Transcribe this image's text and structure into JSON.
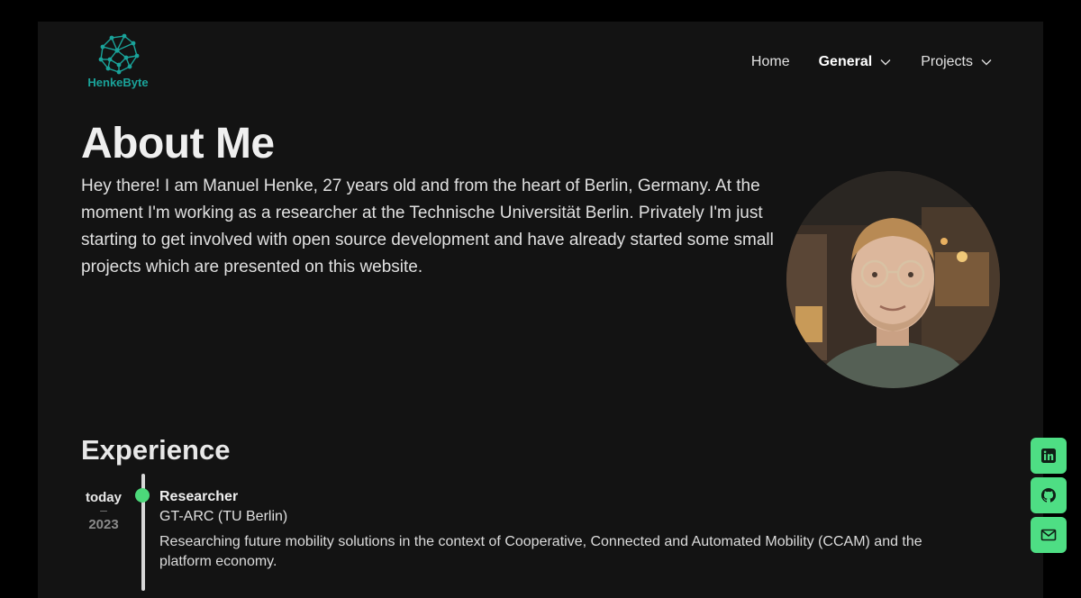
{
  "brand": {
    "name": "HenkeByte",
    "accent": "#1aa39a"
  },
  "nav": {
    "items": [
      {
        "label": "Home"
      },
      {
        "label": "General",
        "active": true,
        "icon": "chevron-down-icon"
      },
      {
        "label": "Projects",
        "icon": "chevron-down-icon"
      }
    ]
  },
  "about": {
    "title": "About Me",
    "text": "Hey there! I am Manuel Henke, 27 years old and from the heart of Berlin, Germany. At the moment I'm working as a researcher at the Technische Universität Berlin. Privately I'm just starting to get involved with open source development and have already started some small projects which are presented on this website."
  },
  "experience": {
    "title": "Experience",
    "entries": [
      {
        "from": "today",
        "dash": "–",
        "to": "2023",
        "role": "Researcher",
        "org": "GT-ARC (TU Berlin)",
        "description": "Researching future mobility solutions in the context of Cooperative, Connected and Automated Mobility (CCAM) and the platform economy."
      }
    ]
  },
  "social": [
    {
      "icon": "linkedin-icon"
    },
    {
      "icon": "github-icon"
    },
    {
      "icon": "mail-icon"
    }
  ],
  "colors": {
    "background": "#000000",
    "panel": "#131313",
    "timeline_dot": "#4cd87a",
    "social_button": "#4ede84"
  }
}
